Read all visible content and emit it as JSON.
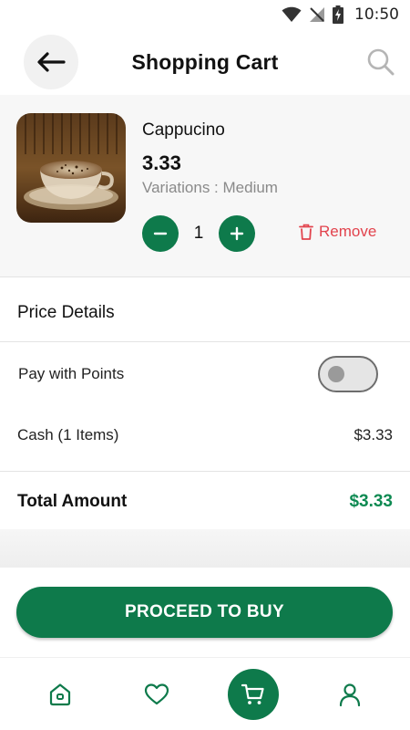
{
  "status_bar": {
    "time": "10:50"
  },
  "header": {
    "title": "Shopping Cart"
  },
  "cart": {
    "items": [
      {
        "name": "Cappucino",
        "price": "3.33",
        "variation": "Variations : Medium",
        "quantity": "1",
        "remove_label": "Remove"
      }
    ]
  },
  "price_details": {
    "title": "Price Details",
    "points_label": "Pay with Points",
    "points_enabled": false,
    "cash_label": "Cash (1 Items)",
    "cash_value": "$3.33",
    "total_label": "Total Amount",
    "total_value": "$3.33"
  },
  "actions": {
    "proceed_label": "PROCEED TO BUY"
  },
  "bottom_nav": {
    "items": [
      "home-icon",
      "heart-icon",
      "cart-icon",
      "user-icon"
    ],
    "active": "cart-icon"
  },
  "colors": {
    "primary": "#0e7a4b",
    "remove": "#e2434d",
    "total": "#0e8a52"
  }
}
